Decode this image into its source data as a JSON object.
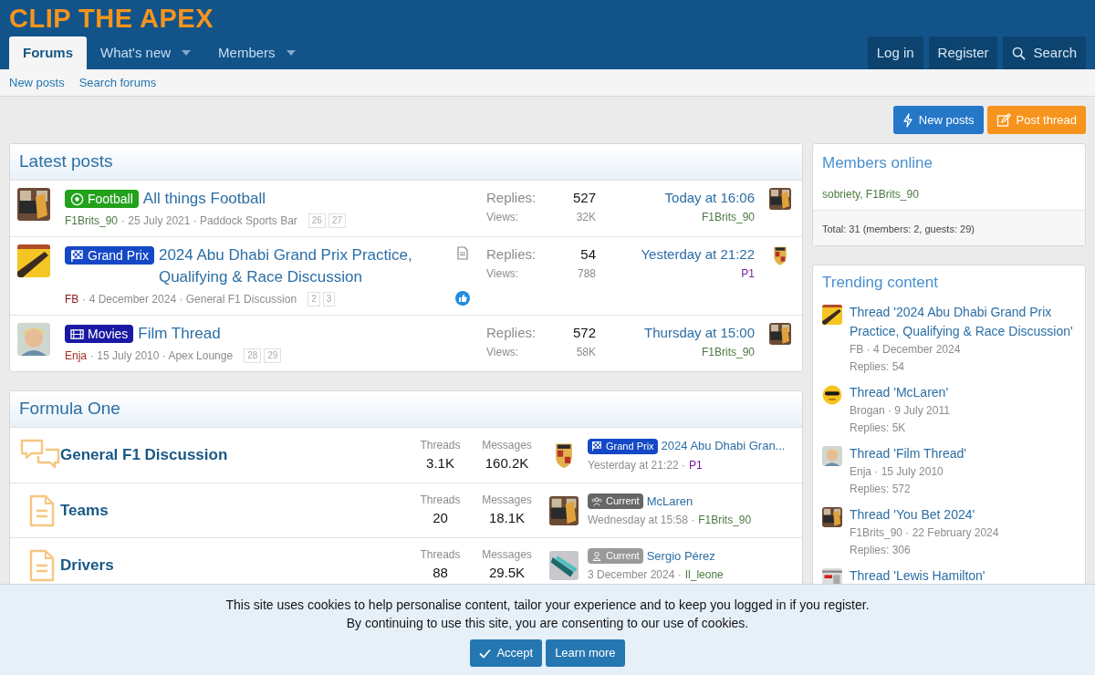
{
  "site": {
    "logo": "CLIP THE APEX"
  },
  "nav": {
    "tabs": [
      {
        "label": "Forums",
        "selected": true,
        "dropdown": false
      },
      {
        "label": "What's new",
        "selected": false,
        "dropdown": true
      },
      {
        "label": "Members",
        "selected": false,
        "dropdown": true
      }
    ],
    "right": [
      {
        "label": "Log in",
        "kind": "text"
      },
      {
        "label": "Register",
        "kind": "text"
      },
      {
        "label": "Search",
        "kind": "search"
      }
    ]
  },
  "subnav": [
    "New posts",
    "Search forums"
  ],
  "actions": [
    {
      "label": "New posts",
      "kind": "new_posts"
    },
    {
      "label": "Post thread",
      "kind": "post_thread"
    }
  ],
  "latest_posts": {
    "title": "Latest posts",
    "threads": [
      {
        "prefix": {
          "label": "Football",
          "kind": "football",
          "color": "#23a11c"
        },
        "title": "All things Football",
        "author": {
          "name": "F1Brits_90",
          "color": "#4a7a3f"
        },
        "details": "· 25 July 2021 · Paddock Sports Bar",
        "pages": [
          "26",
          "27"
        ],
        "has_attachment": false,
        "liked": false,
        "replies_label": "Replies:",
        "replies": "527",
        "views_label": "Views:",
        "views": "32K",
        "last_time": "Today at 16:06",
        "last_user": {
          "name": "F1Brits_90",
          "color": "#4a7a3f"
        }
      },
      {
        "prefix": {
          "label": "Grand Prix",
          "kind": "flag",
          "color": "#1548c6"
        },
        "title": "2024 Abu Dhabi Grand Prix Practice, Qualifying & Race Discussion",
        "author": {
          "name": "FB",
          "color": "#8b1c1c"
        },
        "details": "· 4 December 2024 · General F1 Discussion",
        "pages": [
          "2",
          "3"
        ],
        "has_attachment": true,
        "liked": true,
        "replies_label": "Replies:",
        "replies": "54",
        "views_label": "Views:",
        "views": "788",
        "last_time": "Yesterday at 21:22",
        "last_user": {
          "name": "P1",
          "color": "#7b1fa2"
        }
      },
      {
        "prefix": {
          "label": "Movies",
          "kind": "film",
          "color": "#1919a3"
        },
        "title": "Film Thread",
        "author": {
          "name": "Enja",
          "color": "#a0301e"
        },
        "details": "· 15 July 2010 · Apex Lounge",
        "pages": [
          "28",
          "29"
        ],
        "has_attachment": false,
        "liked": false,
        "replies_label": "Replies:",
        "replies": "572",
        "views_label": "Views:",
        "views": "58K",
        "last_time": "Thursday at 15:00",
        "last_user": {
          "name": "F1Brits_90",
          "color": "#4a7a3f"
        }
      }
    ]
  },
  "formula_one": {
    "title": "Formula One",
    "forums": [
      {
        "kind": "chat",
        "name": "General F1 Discussion",
        "threads_label": "Threads",
        "threads": "3.1K",
        "messages_label": "Messages",
        "messages": "160.2K",
        "last": {
          "prefix": {
            "label": "Grand Prix",
            "kind": "flag",
            "color": "#1548c6"
          },
          "title": "2024 Abu Dhabi Gran...",
          "time": "Yesterday at 21:22 ·",
          "user": {
            "name": "P1",
            "color": "#7b1fa2"
          }
        }
      },
      {
        "kind": "doc",
        "name": "Teams",
        "threads_label": "Threads",
        "threads": "20",
        "messages_label": "Messages",
        "messages": "18.1K",
        "last": {
          "prefix": {
            "label": "Current",
            "kind": "group",
            "color": "#666666"
          },
          "title": "McLaren",
          "time": "Wednesday at 15:58 ·",
          "user": {
            "name": "F1Brits_90",
            "color": "#4a7a3f"
          }
        }
      },
      {
        "kind": "doc",
        "name": "Drivers",
        "threads_label": "Threads",
        "threads": "88",
        "messages_label": "Messages",
        "messages": "29.5K",
        "last": {
          "prefix": {
            "label": "Current",
            "kind": "person",
            "color": "#999999"
          },
          "title": "Sergio Pérez",
          "time": "3 December 2024 ·",
          "user": {
            "name": "Il_leone",
            "color": "#4a7a3f"
          }
        }
      }
    ]
  },
  "members_online": {
    "title": "Members online",
    "members": "sobriety, F1Brits_90",
    "total": "Total: 31 (members: 2, guests: 29)"
  },
  "trending": {
    "title": "Trending content",
    "items": [
      {
        "title": "Thread '2024 Abu Dhabi Grand Prix Practice, Qualifying & Race Discussion'",
        "meta": "FB · 4 December 2024",
        "replies": "Replies: 54"
      },
      {
        "title": "Thread 'McLaren'",
        "meta": "Brogan · 9 July 2011",
        "replies": "Replies: 5K"
      },
      {
        "title": "Thread 'Film Thread'",
        "meta": "Enja · 15 July 2010",
        "replies": "Replies: 572"
      },
      {
        "title": "Thread 'You Bet 2024'",
        "meta": "F1Brits_90 · 22 February 2024",
        "replies": "Replies: 306"
      },
      {
        "title": "Thread 'Lewis Hamilton'"
      }
    ]
  },
  "cookie_notice": {
    "lines": [
      "This site uses cookies to help personalise content, tailor your experience and to keep you logged in if you register.",
      "By continuing to use this site, you are consenting to our use of cookies."
    ],
    "buttons": [
      {
        "label": "Accept",
        "kind": "accept"
      },
      {
        "label": "Learn more",
        "kind": "plain"
      }
    ]
  }
}
